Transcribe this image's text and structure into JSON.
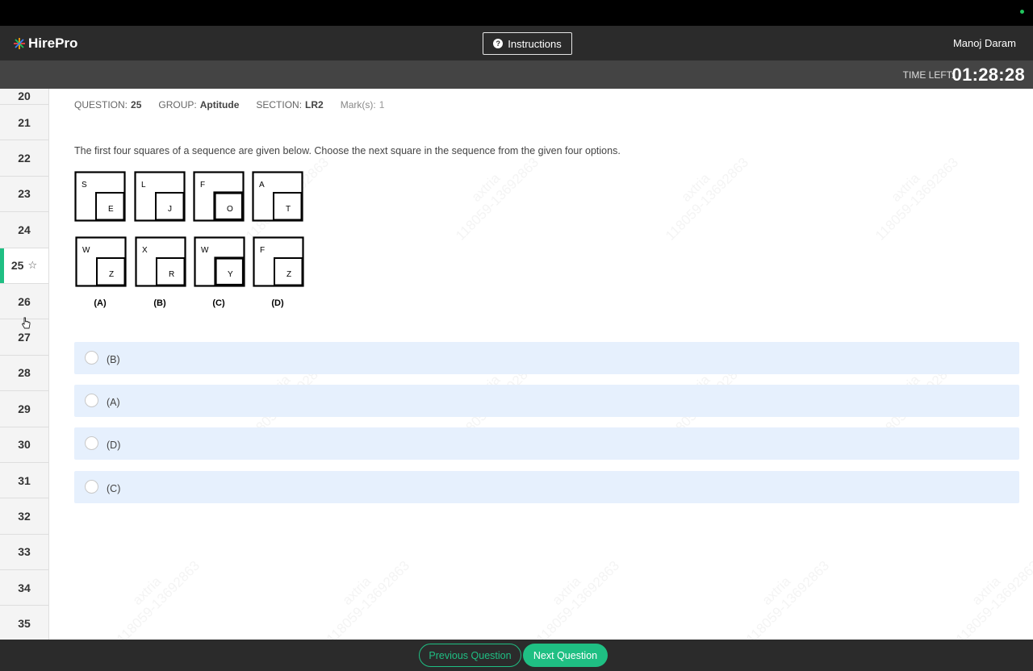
{
  "app": {
    "brand": "HirePro",
    "instructions_label": "Instructions",
    "user_name": "Manoj Daram"
  },
  "timer": {
    "label": "TIME LEFT:",
    "value": "01:28:28"
  },
  "question_nav": {
    "items": [
      {
        "number": "20"
      },
      {
        "number": "21"
      },
      {
        "number": "22"
      },
      {
        "number": "23"
      },
      {
        "number": "24"
      },
      {
        "number": "25",
        "active": true
      },
      {
        "number": "26"
      },
      {
        "number": "27"
      },
      {
        "number": "28"
      },
      {
        "number": "29"
      },
      {
        "number": "30"
      },
      {
        "number": "31"
      },
      {
        "number": "32"
      },
      {
        "number": "33"
      },
      {
        "number": "34"
      },
      {
        "number": "35"
      }
    ],
    "star_glyph": "☆"
  },
  "question": {
    "question_label": "QUESTION:",
    "question_value": "25",
    "group_label": "GROUP:",
    "group_value": "Aptitude",
    "section_label": "SECTION:",
    "section_value": "LR2",
    "marks_label": "Mark(s):",
    "marks_value": "1",
    "text": "The first four squares of a sequence are given below. Choose the next square in the sequence from the given four options."
  },
  "figure": {
    "sequence": [
      {
        "outer": "S",
        "inner": "E"
      },
      {
        "outer": "L",
        "inner": "J"
      },
      {
        "outer": "F",
        "inner": "O"
      },
      {
        "outer": "A",
        "inner": "T"
      }
    ],
    "choices": [
      {
        "outer": "W",
        "inner": "Z",
        "caption": "(A)"
      },
      {
        "outer": "X",
        "inner": "R",
        "caption": "(B)"
      },
      {
        "outer": "W",
        "inner": "Y",
        "caption": "(C)"
      },
      {
        "outer": "F",
        "inner": "Z",
        "caption": "(D)"
      }
    ]
  },
  "options": [
    {
      "label": "(B)"
    },
    {
      "label": "(A)"
    },
    {
      "label": "(D)"
    },
    {
      "label": "(C)"
    }
  ],
  "watermark": {
    "line1": "axtria",
    "line2": "118059-13692863"
  },
  "footer": {
    "prev_label": "Previous Question",
    "next_label": "Next Question"
  },
  "colors": {
    "accent": "#1fbf83",
    "header": "#2b2b2b",
    "subheader": "#444444",
    "option_bg": "#e6f0fd"
  }
}
